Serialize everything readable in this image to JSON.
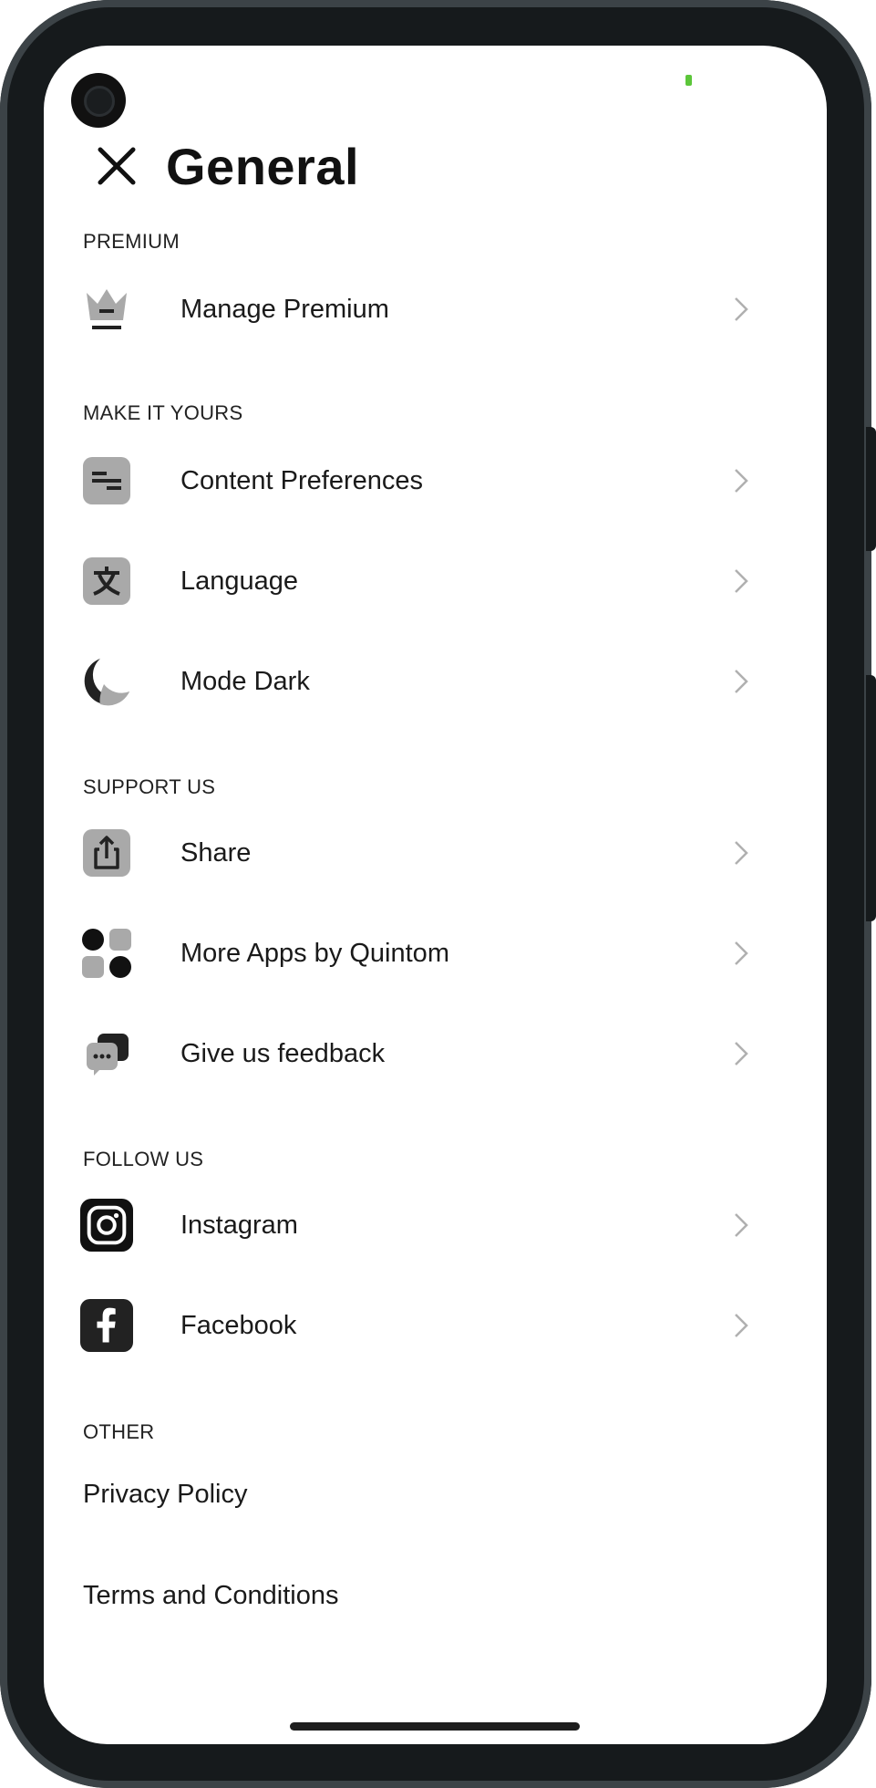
{
  "header": {
    "title": "General"
  },
  "sections": {
    "premium": "PREMIUM",
    "make_it_yours": "MAKE IT YOURS",
    "support_us": "SUPPORT US",
    "follow_us": "FOLLOW US",
    "other": "OTHER"
  },
  "items": {
    "manage_premium": "Manage Premium",
    "content_preferences": "Content Preferences",
    "language": "Language",
    "mode_dark": "Mode Dark",
    "share": "Share",
    "more_apps": "More Apps by Quintom",
    "feedback": "Give us feedback",
    "instagram": "Instagram",
    "facebook": "Facebook",
    "privacy_policy": "Privacy Policy",
    "terms": "Terms and Conditions"
  },
  "icons": {
    "manage_premium": "crown-icon",
    "content_preferences": "sliders-icon",
    "language": "translate-icon",
    "mode_dark": "moon-icon",
    "share": "share-icon",
    "more_apps": "apps-grid-icon",
    "feedback": "chat-bubbles-icon",
    "instagram": "instagram-icon",
    "facebook": "facebook-icon",
    "chevron": "chevron-right-icon",
    "close": "close-icon"
  },
  "colors": {
    "background": "#ffffff",
    "text": "#1a1a1a",
    "icon_gray": "#a9a9a9",
    "icon_dark": "#222222",
    "chevron": "#b0b0b0",
    "frame": "#161a1c"
  }
}
